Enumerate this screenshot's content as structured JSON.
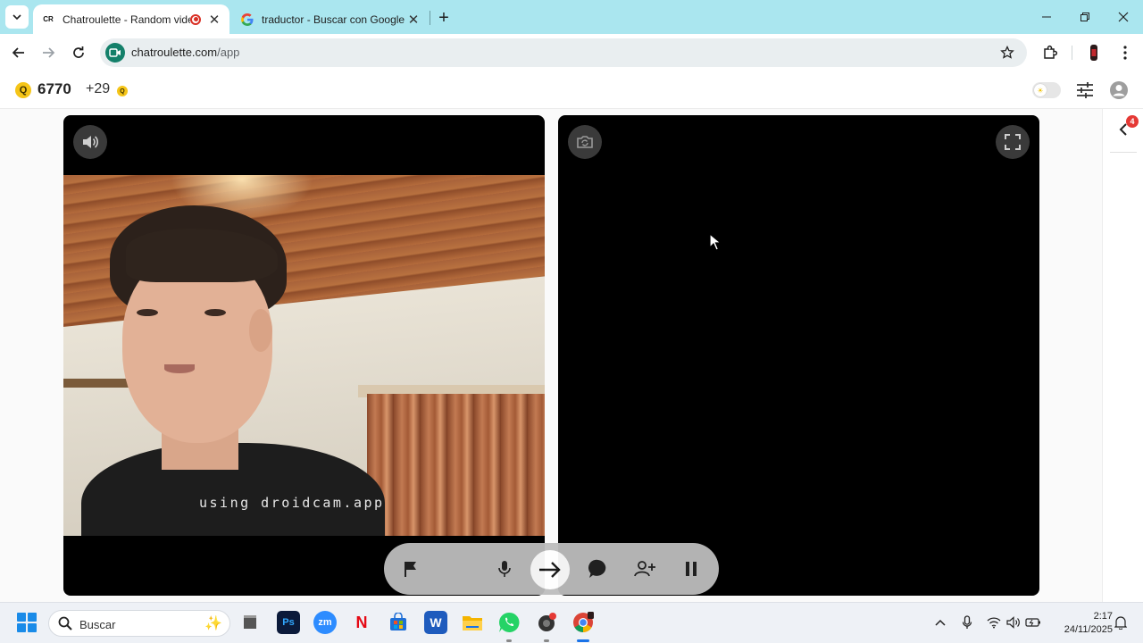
{
  "browser": {
    "tabs": [
      {
        "title": "Chatroulette - Random vide",
        "favicon": "CR",
        "recording": true
      },
      {
        "title": "traductor - Buscar con Google",
        "favicon": "google-icon"
      }
    ],
    "address": {
      "domain": "chatroulette.com",
      "path": "/app"
    }
  },
  "header": {
    "coin_symbol": "Q",
    "coins": "6770",
    "bonus": "+29",
    "bonus_coin_symbol": "Q"
  },
  "sidepanel": {
    "badge": "4"
  },
  "video": {
    "watermark": "using droidcam.app"
  },
  "controls": [
    "report",
    "microphone",
    "next",
    "chat",
    "add-friend",
    "pause"
  ],
  "taskbar": {
    "search_placeholder": "Buscar",
    "apps": [
      {
        "name": "file-explorer-window",
        "label": ""
      },
      {
        "name": "photoshop",
        "label": "Ps"
      },
      {
        "name": "zoom",
        "label": "zm"
      },
      {
        "name": "netflix",
        "label": "N"
      },
      {
        "name": "store",
        "label": ""
      },
      {
        "name": "word",
        "label": "W"
      },
      {
        "name": "folder",
        "label": ""
      },
      {
        "name": "whatsapp",
        "label": ""
      },
      {
        "name": "app-circle",
        "label": ""
      },
      {
        "name": "chrome",
        "label": ""
      }
    ],
    "time": "2:17",
    "date": "24/11/2025"
  },
  "colors": {
    "tabstrip": "#aae6ef",
    "coin": "#f5c518",
    "badge": "#e53935",
    "site_icon": "#14806a"
  }
}
